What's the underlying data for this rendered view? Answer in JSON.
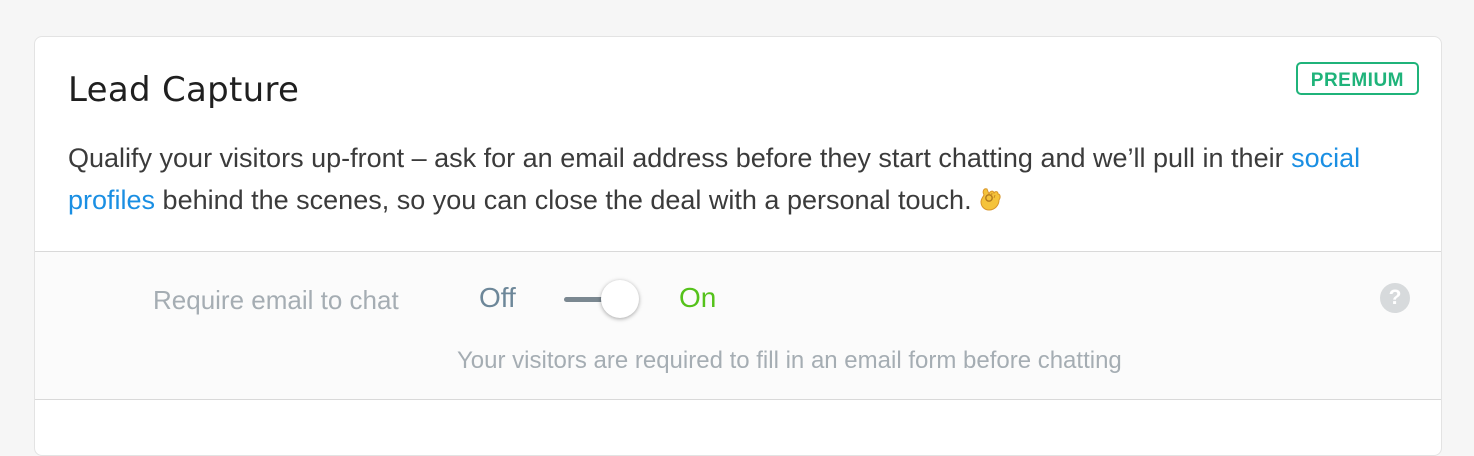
{
  "card": {
    "title": "Lead Capture",
    "badge": "PREMIUM",
    "description_before_link": "Qualify your visitors up-front – ask for an email address before they start chatting and we’ll pull in their ",
    "description_link": "social profiles",
    "description_after_link": " behind the scenes, so you can close the deal with a personal touch.",
    "emoji_icon": "ok-hand-emoji-icon"
  },
  "setting": {
    "label": "Require email to chat",
    "off_label": "Off",
    "on_label": "On",
    "toggle_state": "on",
    "help_icon": "question-mark-icon",
    "help_glyph": "?",
    "hint": "Your visitors are required to fill in an email form before chatting"
  },
  "colors": {
    "accent_link": "#1a8fe3",
    "premium_badge": "#1fb37a",
    "on_label": "#55c21b",
    "off_label": "#6d8799"
  }
}
